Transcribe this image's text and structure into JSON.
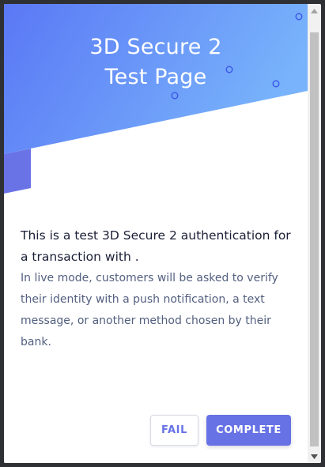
{
  "header": {
    "title_line1": "3D Secure 2",
    "title_line2": "Test Page"
  },
  "message": {
    "headline": "This is a test 3D Secure 2 authentication for a transaction with .",
    "body": "In live mode, customers will be asked to verify their identity with a push notification, a text message, or another method chosen by their bank."
  },
  "actions": {
    "fail_label": "FAIL",
    "complete_label": "COMPLETE"
  },
  "colors": {
    "accent": "#6772e5",
    "hero_start": "#5b7cf7",
    "hero_end": "#75b1fb",
    "heading_text": "#1a1f36",
    "body_text": "#525f7f"
  },
  "icons": {
    "scroll_up": "triangle-up-icon",
    "scroll_down": "triangle-down-icon"
  }
}
